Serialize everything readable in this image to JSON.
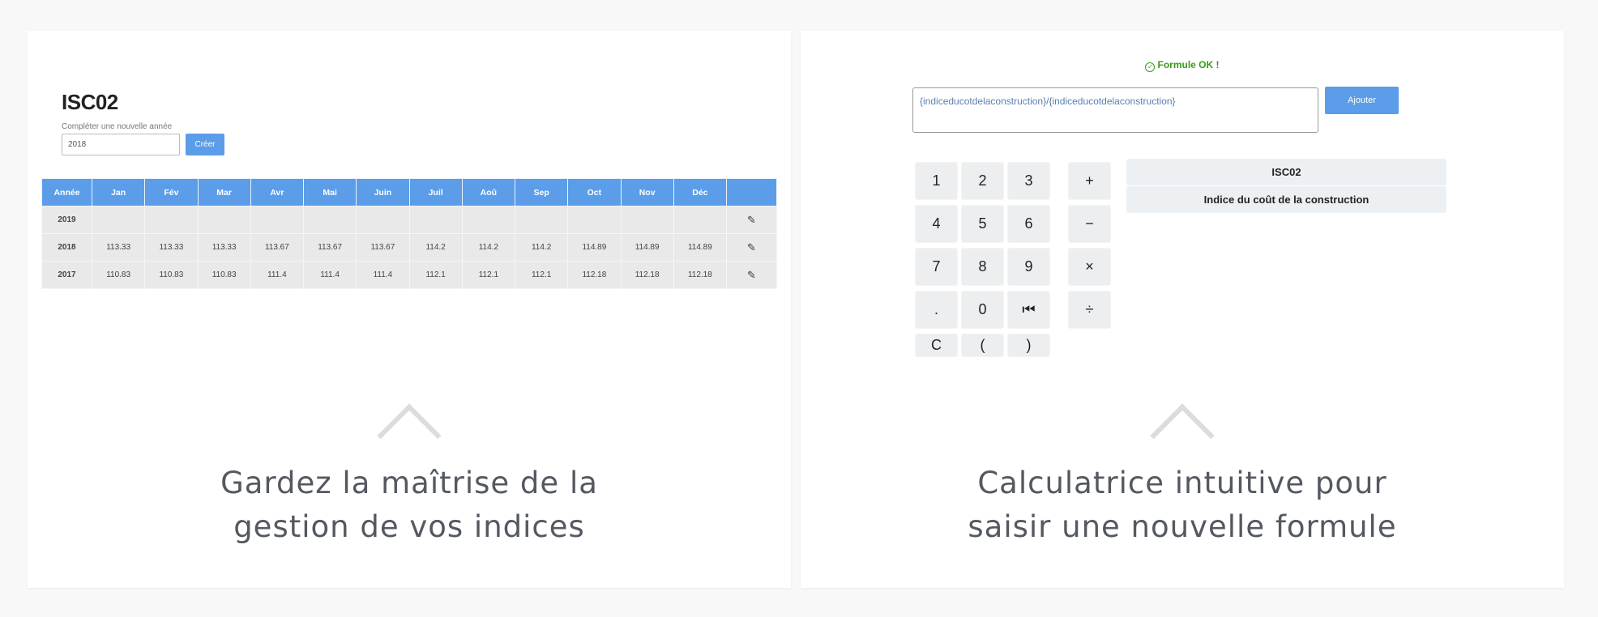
{
  "left_panel": {
    "title": "ISC02",
    "year_label": "Compléter une nouvelle année",
    "year_value": "2018",
    "create_label": "Créer",
    "table": {
      "headers": [
        "Année",
        "Jan",
        "Fév",
        "Mar",
        "Avr",
        "Mai",
        "Juin",
        "Juil",
        "Aoû",
        "Sep",
        "Oct",
        "Nov",
        "Déc",
        ""
      ],
      "rows": [
        {
          "year": "2019",
          "values": [
            "",
            "",
            "",
            "",
            "",
            "",
            "",
            "",
            "",
            "",
            "",
            ""
          ]
        },
        {
          "year": "2018",
          "values": [
            "113.33",
            "113.33",
            "113.33",
            "113.67",
            "113.67",
            "113.67",
            "114.2",
            "114.2",
            "114.2",
            "114.89",
            "114.89",
            "114.89"
          ]
        },
        {
          "year": "2017",
          "values": [
            "110.83",
            "110.83",
            "110.83",
            "111.4",
            "111.4",
            "111.4",
            "112.1",
            "112.1",
            "112.1",
            "112.18",
            "112.18",
            "112.18"
          ]
        }
      ],
      "edit_icon": "pencil-icon"
    },
    "caption_line1": "Gardez la maîtrise de la",
    "caption_line2": "gestion de vos indices"
  },
  "right_panel": {
    "status": "Formule OK !",
    "status_icon": "check-circle-icon",
    "formula": "{indiceducotdelaconstruction}/{indiceducotdelaconstruction}",
    "add_label": "Ajouter",
    "keypad": {
      "digits": [
        "1",
        "2",
        "3",
        "4",
        "5",
        "6",
        "7",
        "8",
        "9",
        ".",
        "0",
        "⏮"
      ],
      "bottom": [
        "C",
        "(",
        ")"
      ],
      "operators": [
        "+",
        "−",
        "×",
        "÷"
      ]
    },
    "index_code": "ISC02",
    "index_name": "Indice du coût de la construction",
    "caption_line1": "Calculatrice intuitive pour",
    "caption_line2": "saisir une nouvelle formule"
  },
  "colors": {
    "accent": "#5b9de8",
    "ok": "#3a9a1a",
    "caption": "#545861"
  }
}
